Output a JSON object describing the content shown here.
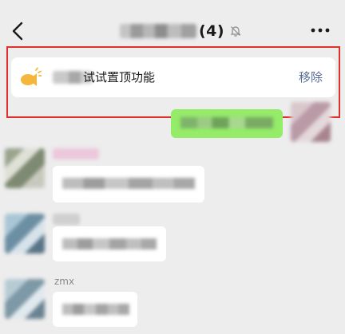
{
  "header": {
    "back_icon": "chevron-left-icon",
    "member_count": "(4)",
    "mute_icon": "bell-off-icon",
    "more_icon": "ellipsis-icon"
  },
  "pinned": {
    "icon": "megaphone-icon",
    "text": "试试置顶功能",
    "remove_label": "移除",
    "frame_color": "#e0302a"
  },
  "messages": [
    {
      "sender": "",
      "side": "right"
    },
    {
      "sender": "",
      "side": "left"
    },
    {
      "sender": "",
      "side": "left"
    },
    {
      "sender": "zmx",
      "side": "left"
    }
  ],
  "colors": {
    "background": "#ededed",
    "outgoing_bubble": "#95ec69",
    "incoming_bubble": "#ffffff",
    "link": "#576b95"
  }
}
